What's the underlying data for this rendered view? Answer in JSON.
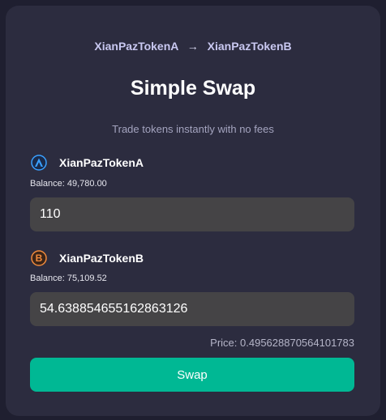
{
  "header": {
    "token_from": "XianPazTokenA",
    "arrow": "→",
    "token_to": "XianPazTokenB",
    "title": "Simple Swap",
    "subtitle": "Trade tokens instantly with no fees"
  },
  "token_a": {
    "icon": "token-a-logo-icon",
    "name": "XianPazTokenA",
    "balance": "Balance: 49,780.00",
    "amount": "110"
  },
  "token_b": {
    "icon": "token-b-logo-icon",
    "name": "XianPazTokenB",
    "balance": "Balance: 75,109.52",
    "amount": "54.638854655162863126"
  },
  "price": "Price: 0.495628870564101783",
  "swap_label": "Swap",
  "colors": {
    "background": "#1f1f30",
    "card": "#2c2c3f",
    "input": "#454446",
    "accent": "#00b894",
    "pair_text": "#c9c8f1"
  }
}
